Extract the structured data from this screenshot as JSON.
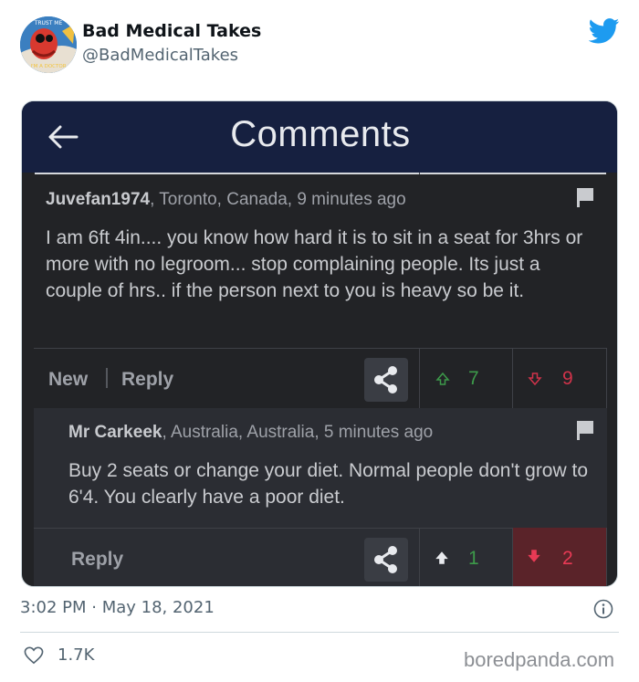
{
  "tweet": {
    "display_name": "Bad Medical Takes",
    "handle": "@BadMedicalTakes",
    "avatar_top_text": "TRUST ME",
    "avatar_bottom_text": "I'M A DOCTOR",
    "timestamp": "3:02 PM · May 18, 2021",
    "likes": "1.7K",
    "watermark": "boredpanda.com",
    "brand_color": "#1d9bf0"
  },
  "screenshot": {
    "title": "Comments",
    "comment1": {
      "author": "Juvefan1974",
      "meta": ", Toronto, Canada, 9 minutes ago",
      "body": "I am 6ft 4in.... you know how hard it is to sit in a seat for 3hrs or more with no legroom... stop complaining people. Its just a couple of hrs.. if the person next to you is heavy so be it.",
      "new_label": "New",
      "reply_label": "Reply",
      "upvotes": "7",
      "downvotes": "9"
    },
    "comment2": {
      "author": "Mr Carkeek",
      "meta": ", Australia, Australia, 5 minutes ago",
      "body": "Buy 2 seats or change your diet. Normal people don't grow to 6'4. You clearly have a poor diet.",
      "reply_label": "Reply",
      "upvotes": "1",
      "downvotes": "2"
    },
    "colors": {
      "header_bg": "#162040",
      "upvote": "#3d9a4a",
      "downvote": "#d0334a"
    }
  }
}
